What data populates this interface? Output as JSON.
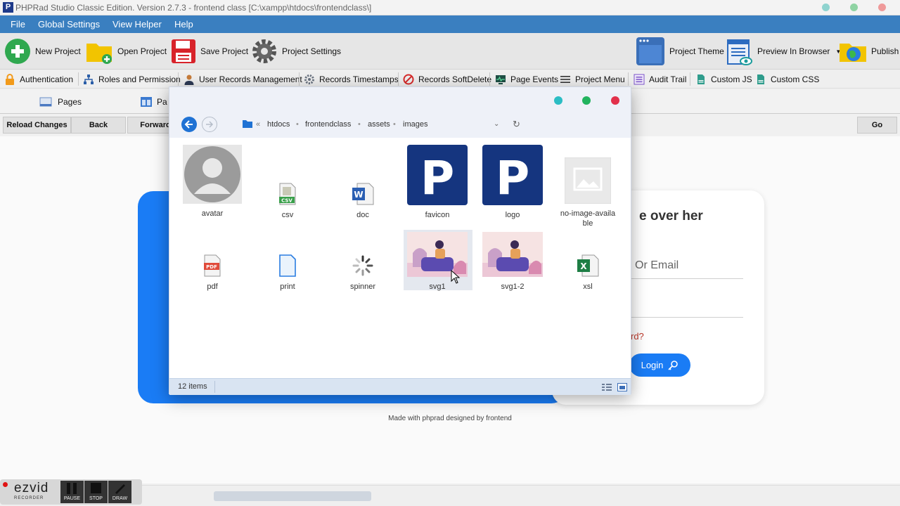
{
  "app": {
    "title": "PHPRad Studio Classic Edition.  Version 2.7.3 - frontend class [C:\\xampp\\htdocs\\frontendclass\\]",
    "icon_letter": "P"
  },
  "menu": [
    "File",
    "Global Settings",
    "View Helper",
    "Help"
  ],
  "toolbar1": {
    "new_project": "New Project",
    "open_project": "Open Project",
    "save_project": "Save Project",
    "project_settings": "Project Settings",
    "project_theme": "Project Theme",
    "preview_in_browser": "Preview In Browser",
    "publish": "Publish"
  },
  "toolbar2": {
    "authentication": "Authentication",
    "roles_permission": "Roles and Permission",
    "user_records": "User Records Management",
    "records_timestamps": "Records Timestamps",
    "records_softdelete": "Records SoftDelete",
    "page_events": "Page Events",
    "project_menu": "Project Menu",
    "audit_trail": "Audit Trail",
    "custom_js": "Custom JS",
    "custom_css": "Custom CSS"
  },
  "tabs": {
    "pages": "Pages",
    "pa": "Pa"
  },
  "nav": {
    "reload": "Reload Changes",
    "back": "Back",
    "forward": "Forward",
    "go": "Go"
  },
  "page": {
    "heading_fragment": "e over her",
    "email_placeholder_fragment": "Or Email",
    "forgot_fragment": "rd?",
    "login_button": "Login",
    "footer": "Made with phprad designed by frontend"
  },
  "dialog": {
    "breadcrumb": {
      "chevrons": "«",
      "parts": [
        "htdocs",
        "frontendclass",
        "assets",
        "images"
      ]
    },
    "files": [
      {
        "name": "avatar",
        "kind": "avatar"
      },
      {
        "name": "csv",
        "kind": "csv"
      },
      {
        "name": "doc",
        "kind": "doc"
      },
      {
        "name": "favicon",
        "kind": "brand-p"
      },
      {
        "name": "logo",
        "kind": "brand-p"
      },
      {
        "name": "no-image-available",
        "kind": "noimage",
        "label_lines": [
          "no-image-availa",
          "ble"
        ]
      },
      {
        "name": "pdf",
        "kind": "pdf"
      },
      {
        "name": "print",
        "kind": "print"
      },
      {
        "name": "spinner",
        "kind": "spinner"
      },
      {
        "name": "svg1",
        "kind": "illustration",
        "selected": true
      },
      {
        "name": "svg1-2",
        "kind": "illustration"
      },
      {
        "name": "xsl",
        "kind": "excel"
      }
    ],
    "status": "12 items",
    "brand_letter": "P",
    "csv_tag": "CSV",
    "doc_tag": "W",
    "pdf_tag": "PDF",
    "xls_tag": "X"
  },
  "ezvid": {
    "logo": "ezvid",
    "sub": "RECORDER",
    "pause": "PAUSE",
    "stop": "STOP",
    "draw": "DRAW"
  },
  "colors": {
    "menubar": "#3a7fc0",
    "brand_blue": "#15357f",
    "card_blue": "#1a7cf5",
    "dot_teal": "#2bbdc4",
    "dot_green": "#22b35e",
    "dot_red": "#e2304b"
  }
}
